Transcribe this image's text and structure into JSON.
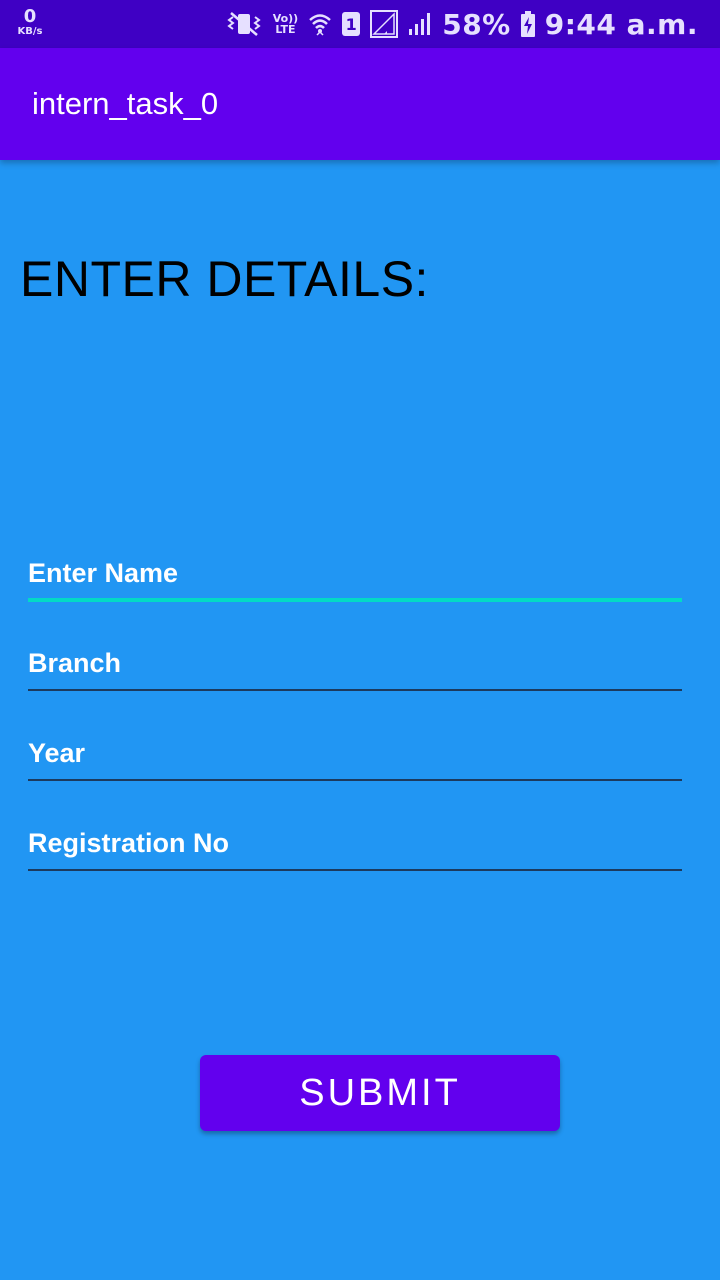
{
  "status_bar": {
    "speed_value": "0",
    "speed_unit": "KB/s",
    "volte_top": "Vo))",
    "volte_bottom": "LTE",
    "sim_number": "1",
    "battery_percent": "58%",
    "time": "9:44 a.m.",
    "icons": [
      "vibrate-icon",
      "volte-icon",
      "wifi-icon",
      "sim-1-icon",
      "signal-icon",
      "signal-icon",
      "battery-charging-icon"
    ]
  },
  "app_bar": {
    "title": "intern_task_0"
  },
  "form": {
    "heading": "ENTER DETAILS:",
    "fields": [
      {
        "placeholder": "Enter Name",
        "value": "",
        "focused": true
      },
      {
        "placeholder": "Branch",
        "value": ""
      },
      {
        "placeholder": "Year",
        "value": ""
      },
      {
        "placeholder": "Registration No",
        "value": ""
      }
    ],
    "submit_label": "SUBMIT"
  },
  "colors": {
    "status_bar": "#3f00c4",
    "app_bar": "#6200EE",
    "background": "#2196F3",
    "focus_underline": "#03DAC5",
    "button": "#6200EE"
  }
}
